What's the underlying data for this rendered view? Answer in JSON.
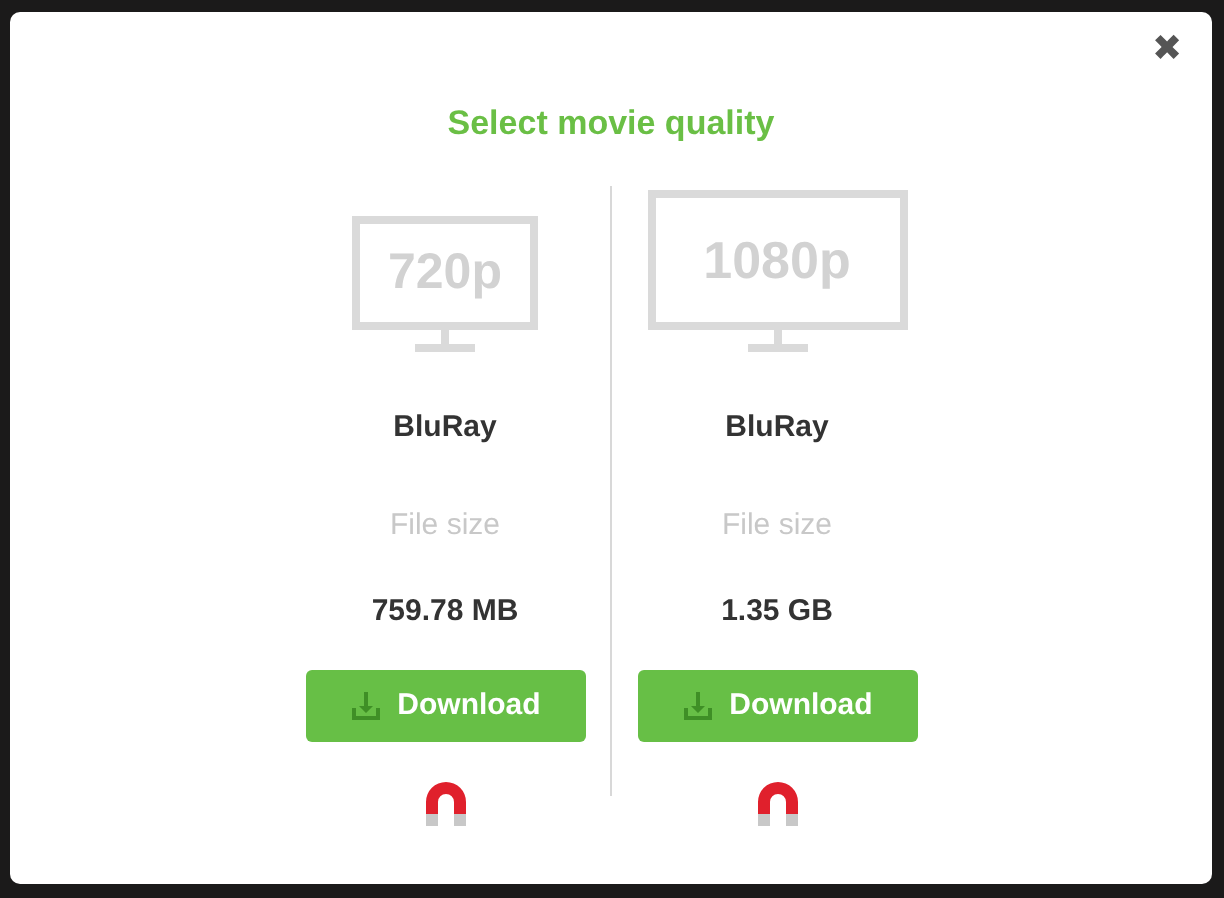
{
  "dialog": {
    "title": "Select movie quality",
    "close": "✖"
  },
  "options": [
    {
      "resolution": "720p",
      "source": "BluRay",
      "size_label": "File size",
      "size": "759.78 MB",
      "button": "Download",
      "kind": "small"
    },
    {
      "resolution": "1080p",
      "source": "BluRay",
      "size_label": "File size",
      "size": "1.35 GB",
      "button": "Download",
      "kind": "large"
    }
  ]
}
